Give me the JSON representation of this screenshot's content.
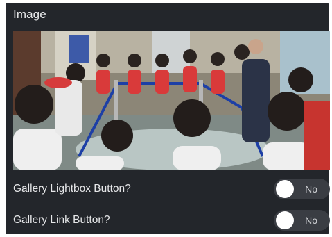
{
  "panel": {
    "title": "Image"
  },
  "image": {
    "alt_subject": "photo-children-exhibit"
  },
  "settings": [
    {
      "label": "Gallery Lightbox Button?",
      "state": "No",
      "on": false
    },
    {
      "label": "Gallery Link Button?",
      "state": "No",
      "on": false
    }
  ],
  "colors": {
    "panel_bg": "#23262b",
    "toggle_bg": "#3a3d43",
    "knob": "#ffffff",
    "text": "#e6e7e9"
  }
}
